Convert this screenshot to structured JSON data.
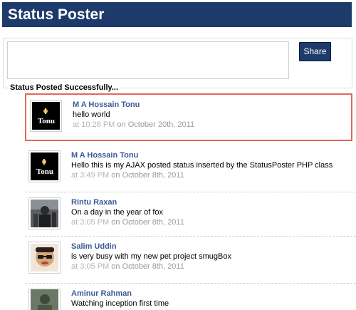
{
  "header": {
    "title": "Status Poster"
  },
  "composer": {
    "input_value": "",
    "input_placeholder": "",
    "share_label": "Share"
  },
  "status_message": "Status Posted Successfully...",
  "feed": [
    {
      "name": "M A Hossain Tonu",
      "text": "hello world",
      "time": "at 10:28 PM",
      "date_prefix": "on",
      "date": "October 20th, 2011",
      "avatar_text": "Tonu",
      "highlight": true
    },
    {
      "name": "M A Hossain Tonu",
      "text": "Hello this is my AJAX posted status inserted by the StatusPoster PHP class",
      "time": "at 3:49 PM",
      "date_prefix": "on",
      "date": "October 8th, 2011",
      "avatar_text": "Tonu",
      "highlight": false
    },
    {
      "name": "Rintu Raxan",
      "text": "On a day in the year of fox",
      "time": "at 3:05 PM",
      "date_prefix": "on",
      "date": "October 8th, 2011",
      "avatar_text": "",
      "highlight": false
    },
    {
      "name": "Salim Uddin",
      "text": "is very busy with my new pet project smugBox",
      "time": "at 3:05 PM",
      "date_prefix": "on",
      "date": "October 8th, 2011",
      "avatar_text": "",
      "highlight": false
    },
    {
      "name": "Aminur Rahman",
      "text": "Watching inception first time",
      "time": "",
      "date_prefix": "",
      "date": "",
      "avatar_text": "",
      "highlight": false
    }
  ],
  "colors": {
    "header_bg": "#1d3a6a",
    "share_bg": "#1f3b6c",
    "name_color": "#3b5998",
    "highlight_border": "#e06a57"
  }
}
